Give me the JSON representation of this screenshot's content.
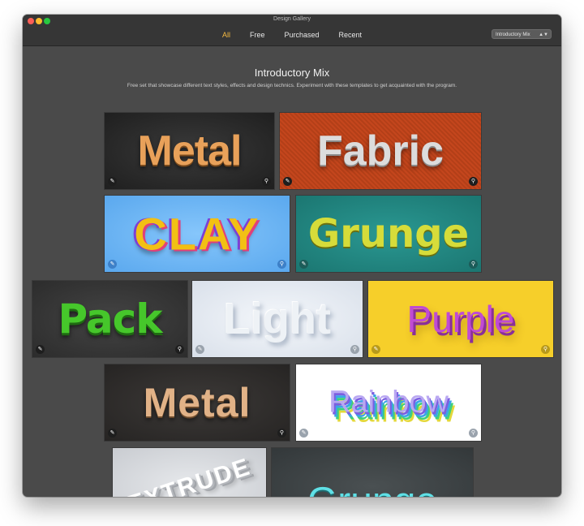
{
  "window": {
    "title": "Design Gallery"
  },
  "tabs": [
    {
      "label": "All",
      "active": true
    },
    {
      "label": "Free",
      "active": false
    },
    {
      "label": "Purchased",
      "active": false
    },
    {
      "label": "Recent",
      "active": false
    }
  ],
  "collection_select": {
    "value": "Introductory Mix"
  },
  "header": {
    "title": "Introductory Mix",
    "description": "Free set that showcase different text styles, effects and design technics. Experiment with these templates to get acquainted with the program."
  },
  "templates": [
    {
      "label": "Metal"
    },
    {
      "label": "Fabric"
    },
    {
      "label": "CLAY"
    },
    {
      "label": "Grunge"
    },
    {
      "label": "Pack"
    },
    {
      "label": "Light"
    },
    {
      "label": "Purple"
    },
    {
      "label": "Metal"
    },
    {
      "label": "Rainbow"
    },
    {
      "label": "EXTRUDE"
    },
    {
      "label": "Grunge"
    }
  ],
  "icons": {
    "edit": "pencil-icon",
    "zoom": "magnifier-icon"
  },
  "colors": {
    "accent": "#f5b942",
    "window_bg": "#4a4a4a",
    "titlebar_bg": "#363636"
  }
}
